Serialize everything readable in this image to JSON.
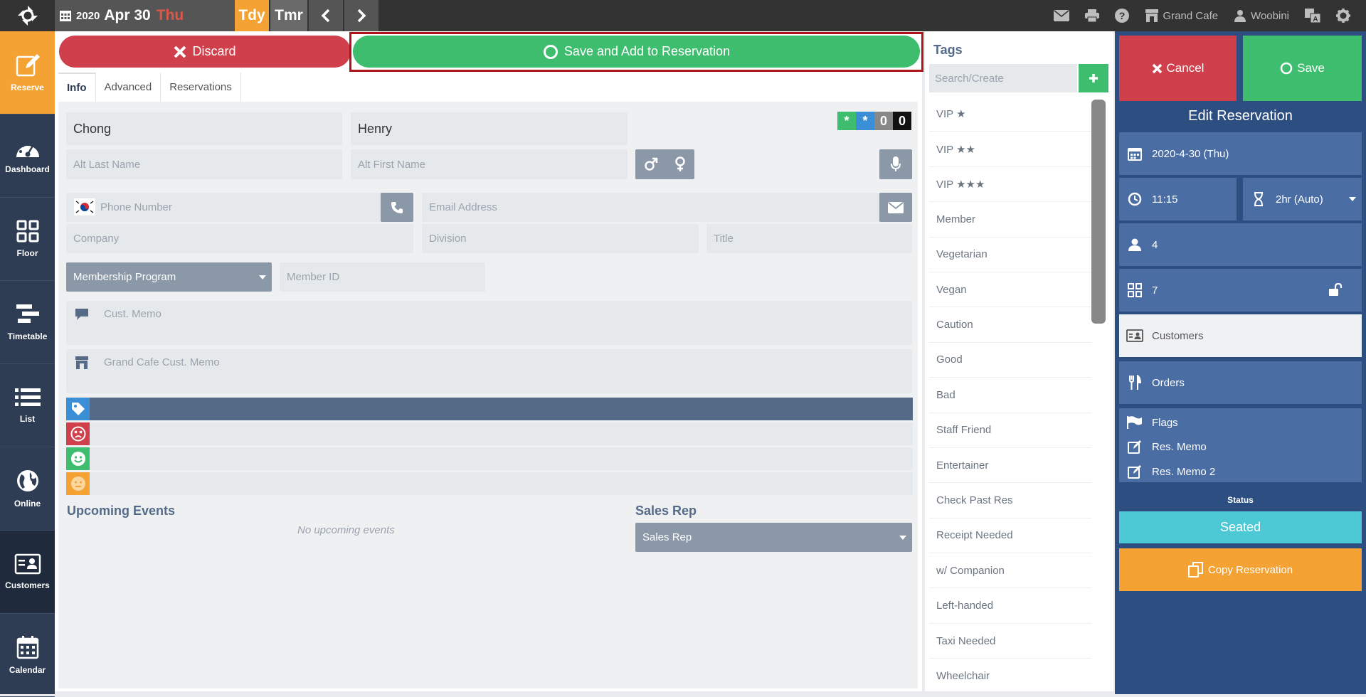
{
  "topbar": {
    "year": "2020",
    "month_day": "Apr 30",
    "weekday": "Thu",
    "today_label": "Tdy",
    "tomorrow_label": "Tmr",
    "store_name": "Grand Cafe",
    "user_name": "Woobini"
  },
  "nav": [
    {
      "label": "Reserve",
      "icon": "edit-icon"
    },
    {
      "label": "Dashboard",
      "icon": "gauge-icon"
    },
    {
      "label": "Floor",
      "icon": "grid-icon"
    },
    {
      "label": "Timetable",
      "icon": "timetable-icon"
    },
    {
      "label": "List",
      "icon": "list-icon"
    },
    {
      "label": "Online",
      "icon": "globe-icon"
    },
    {
      "label": "Customers",
      "icon": "id-card-icon"
    },
    {
      "label": "Calendar",
      "icon": "calendar-icon"
    }
  ],
  "actions": {
    "discard": "Discard",
    "save_add": "Save and Add to Reservation"
  },
  "tabs": [
    "Info",
    "Advanced",
    "Reservations"
  ],
  "form": {
    "last_name": "Chong",
    "first_name": "Henry",
    "alt_last_name_ph": "Alt Last Name",
    "alt_first_name_ph": "Alt First Name",
    "phone_ph": "Phone Number",
    "email_ph": "Email Address",
    "company_ph": "Company",
    "division_ph": "Division",
    "title_ph": "Title",
    "membership_program": "Membership Program",
    "member_id_ph": "Member ID",
    "cust_memo_ph": "Cust. Memo",
    "store_memo_ph": "Grand Cafe Cust. Memo",
    "badges": [
      "*",
      "*",
      "0",
      "0"
    ]
  },
  "upcoming": {
    "title": "Upcoming Events",
    "empty": "No upcoming events"
  },
  "sales_rep": {
    "title": "Sales Rep",
    "value": "Sales Rep"
  },
  "tags": {
    "title": "Tags",
    "search_ph": "Search/Create",
    "items": [
      "VIP ★",
      "VIP ★★",
      "VIP ★★★",
      "Member",
      "Vegetarian",
      "Vegan",
      "Caution",
      "Good",
      "Bad",
      "Staff Friend",
      "Entertainer",
      "Check Past Res",
      "Receipt Needed",
      "w/ Companion",
      "Left-handed",
      "Taxi Needed",
      "Wheelchair"
    ]
  },
  "reservation": {
    "cancel": "Cancel",
    "save": "Save",
    "title": "Edit Reservation",
    "date": "2020-4-30 (Thu)",
    "time": "11:15",
    "duration": "2hr (Auto)",
    "party_size": "4",
    "table": "7",
    "customers": "Customers",
    "orders": "Orders",
    "flags": "Flags",
    "res_memo": "Res. Memo",
    "res_memo2": "Res. Memo 2",
    "status_label": "Status",
    "status": "Seated",
    "copy": "Copy Reservation"
  },
  "colors": {
    "discard": "#d0404c",
    "save": "#3ebd6e",
    "nav_active": "#f4a233",
    "panel": "#2d4e80",
    "seated": "#4cc9d5"
  }
}
